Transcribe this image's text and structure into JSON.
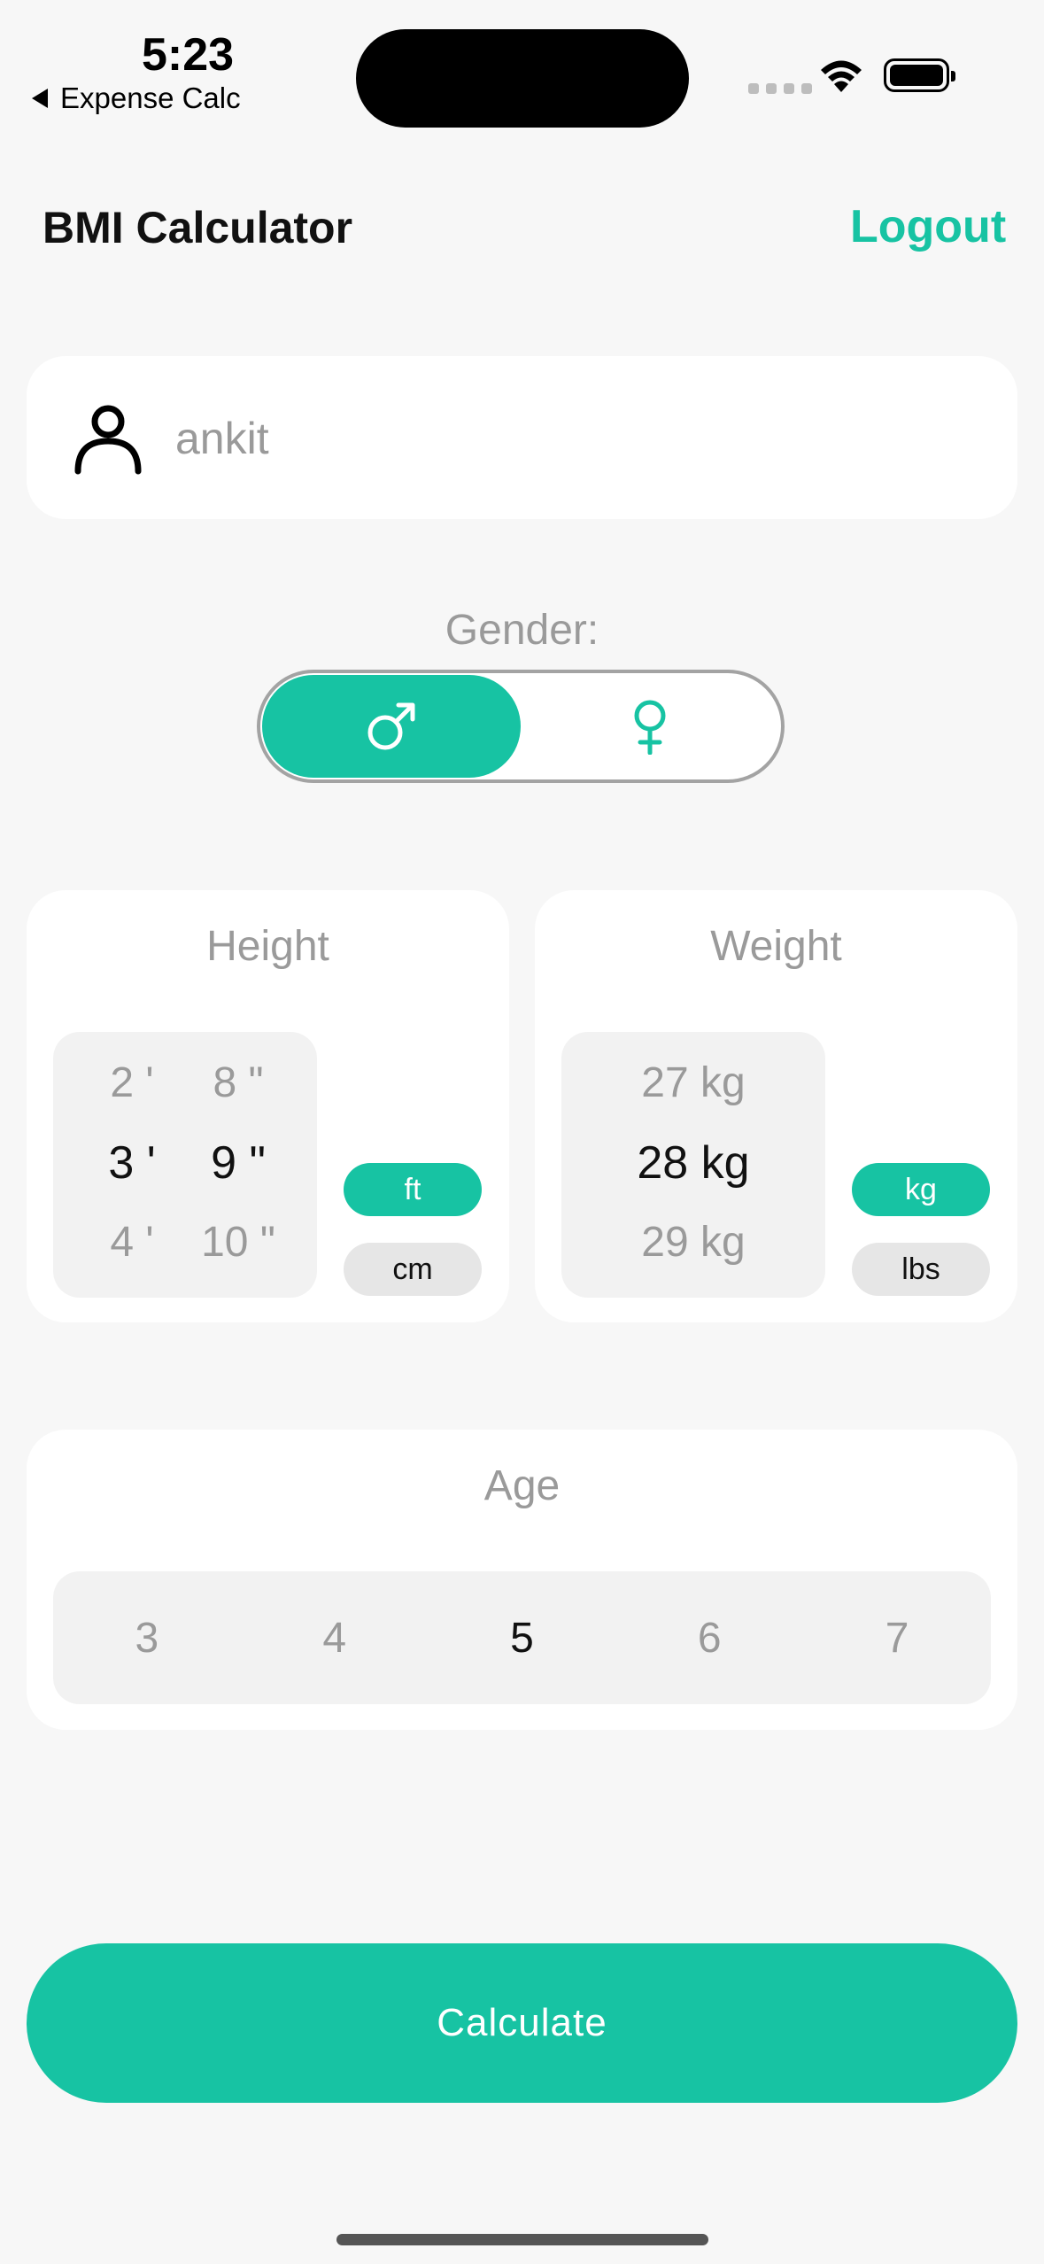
{
  "status_bar": {
    "time": "5:23",
    "back_app": "Expense Calc"
  },
  "header": {
    "title": "BMI Calculator",
    "logout_label": "Logout"
  },
  "name_field": {
    "value": "ankit",
    "icon": "person-icon"
  },
  "gender": {
    "label": "Gender:",
    "selected": "male",
    "options": [
      "male",
      "female"
    ]
  },
  "height": {
    "title": "Height",
    "rows": [
      {
        "ft": "2 '",
        "in": "8 \""
      },
      {
        "ft": "3 '",
        "in": "9 \""
      },
      {
        "ft": "4 '",
        "in": "10 \""
      }
    ],
    "units": {
      "active": "ft",
      "inactive": "cm"
    }
  },
  "weight": {
    "title": "Weight",
    "rows": [
      "27 kg",
      "28 kg",
      "29 kg"
    ],
    "units": {
      "active": "kg",
      "inactive": "lbs"
    }
  },
  "age": {
    "title": "Age",
    "values": [
      "3",
      "4",
      "5",
      "6",
      "7"
    ],
    "selected": "5"
  },
  "calculate_label": "Calculate",
  "colors": {
    "accent": "#17c3a3",
    "muted": "#9a9a9a",
    "background": "#f7f7f7"
  }
}
